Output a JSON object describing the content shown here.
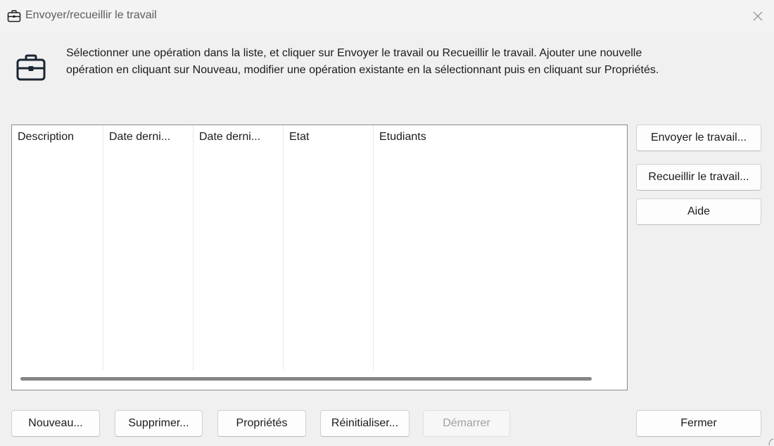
{
  "window": {
    "title": "Envoyer/recueillir le travail",
    "title_icon": "briefcase-icon",
    "close_icon": "close-icon"
  },
  "header": {
    "icon": "briefcase-icon",
    "line1": "Sélectionner une opération dans la liste, et cliquer sur Envoyer le travail ou Recueillir le travail. Ajouter une nouvelle",
    "line2": "opération en cliquant sur Nouveau, modifier une opération existante en la sélectionnant puis en cliquant sur Propriétés."
  },
  "list": {
    "columns": [
      "Description",
      "Date derni...",
      "Date derni...",
      "Etat",
      "Etudiants"
    ],
    "rows": []
  },
  "side_buttons": {
    "send": "Envoyer le travail...",
    "collect": "Recueillir le travail...",
    "help": "Aide"
  },
  "bottom_buttons": {
    "new": "Nouveau...",
    "delete": "Supprimer...",
    "properties": "Propriétés",
    "reset": "Réinitialiser...",
    "start": "Démarrer",
    "close": "Fermer"
  },
  "colors": {
    "window_bg": "#f3f3f3",
    "list_bg": "#ffffff",
    "disabled_text": "#a0a0a0"
  }
}
